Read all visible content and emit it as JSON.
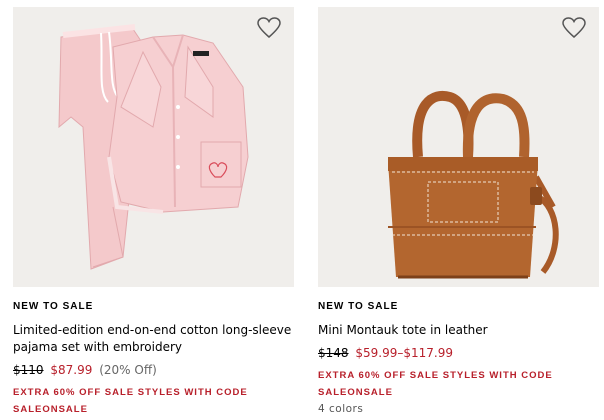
{
  "products": [
    {
      "badge": "NEW TO SALE",
      "title": "Limited-edition end-on-end cotton long-sleeve pajama set with embroidery",
      "price_original": "$110",
      "price_sale": "$87.99",
      "price_discount": "(20% Off)",
      "promo_line1": "EXTRA 60% OFF SALE STYLES WITH CODE",
      "promo_line2": "SALEONSALE",
      "image_icon": "pink-pajama-set-image",
      "favorite_icon": "heart-icon"
    },
    {
      "badge": "NEW TO SALE",
      "title": "Mini Montauk tote in leather",
      "price_original": "$148",
      "price_sale": "$59.99–$117.99",
      "promo_line1": "EXTRA 60% OFF SALE STYLES WITH CODE",
      "promo_line2": "SALEONSALE",
      "colors": "4 colors",
      "image_icon": "leather-tote-bag-image",
      "favorite_icon": "heart-icon"
    }
  ],
  "colors": {
    "sale_red": "#b8202b",
    "image_bg": "#f0eeeb",
    "pajama_pink": "#f2c6c8",
    "leather_tan": "#b0632e"
  }
}
